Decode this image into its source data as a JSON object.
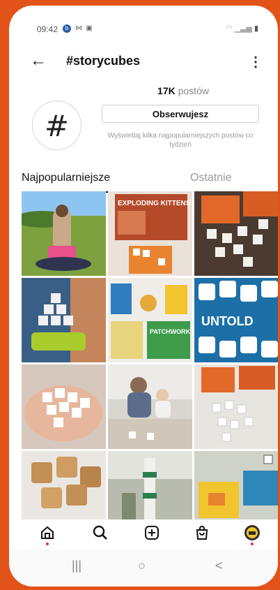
{
  "status_bar": {
    "time": "09:42",
    "icons_left": [
      "b-circle-icon",
      "m-icon",
      "square-icon"
    ],
    "icons_right": [
      "wifi-icon",
      "signal-icon",
      "battery-icon"
    ]
  },
  "header": {
    "title": "#storycubes",
    "back_icon": "arrow-left-icon",
    "more_icon": "more-vertical-icon"
  },
  "profile": {
    "avatar_symbol": "#",
    "posts_count": "17K",
    "posts_label": "postów",
    "follow_label": "Obserwujesz",
    "hint": "Wyświetlaj kilka najpopularniejszych postów co tydzień"
  },
  "tabs": [
    {
      "label": "Najpopularniejsze",
      "active": true
    },
    {
      "label": "Ostatnie",
      "active": false
    }
  ],
  "grid": {
    "tiles": [
      {
        "name": "woman-in-grass",
        "bg": "#7da13e"
      },
      {
        "name": "exploding-kittens-box",
        "bg": "#b54a2b",
        "text": "EXPLODING KITTENS"
      },
      {
        "name": "orange-box-dice",
        "bg": "#4a3a30"
      },
      {
        "name": "dice-stack-green",
        "bg": "#3a5f86"
      },
      {
        "name": "board-games-flatlay",
        "bg": "#2f7dbf",
        "text": "PATCHWORK"
      },
      {
        "name": "untold-dice",
        "bg": "#1d6fa8",
        "text": "UNTOLD"
      },
      {
        "name": "dice-in-hand",
        "bg": "#d6c8bc"
      },
      {
        "name": "family-table",
        "bg": "#d9d6cf"
      },
      {
        "name": "dice-on-table",
        "bg": "#e8e4df"
      },
      {
        "name": "wooden-dice",
        "bg": "#c28f55"
      },
      {
        "name": "dice-tower",
        "bg": "#9aa08b"
      },
      {
        "name": "game-boxes",
        "bg": "#2f86b8"
      }
    ]
  },
  "bottom_nav": [
    {
      "name": "home-icon",
      "dot": true
    },
    {
      "name": "search-icon",
      "dot": false
    },
    {
      "name": "add-post-icon",
      "dot": false
    },
    {
      "name": "shop-icon",
      "dot": false
    },
    {
      "name": "profile-avatar-icon",
      "dot": true
    }
  ],
  "system_nav": {
    "recent": "|||",
    "home": "○",
    "back": "<"
  },
  "colors": {
    "frame": "#e2531a",
    "text": "#111111",
    "muted": "#999999",
    "notif_dot": "#e0245e"
  }
}
